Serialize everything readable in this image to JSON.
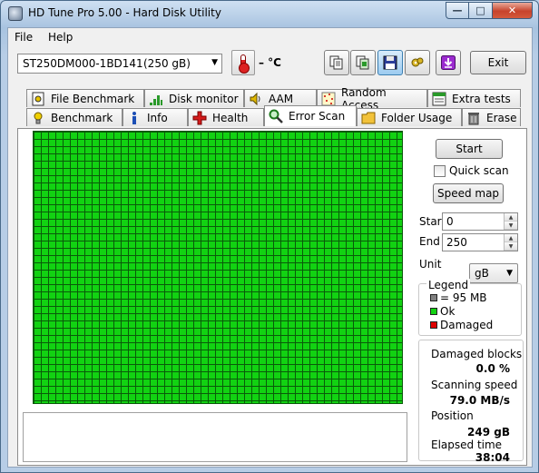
{
  "window": {
    "title": "HD Tune Pro 5.00 - Hard Disk Utility",
    "minimize": "—",
    "maximize": "□",
    "close": "✕"
  },
  "menu": {
    "file": "File",
    "help": "Help"
  },
  "toolbar": {
    "drive_name": "ST250DM000-1BD141",
    "drive_size": "(250 gB)",
    "temperature": "– °C",
    "exit_label": "Exit",
    "icons": [
      "copy-info-icon",
      "copy-screenshot-icon",
      "save-icon",
      "options-icon",
      "download-icon"
    ]
  },
  "tabs_top": [
    {
      "label": "File Benchmark",
      "icon": "file-benchmark-icon"
    },
    {
      "label": "Disk monitor",
      "icon": "disk-monitor-icon"
    },
    {
      "label": "AAM",
      "icon": "speaker-icon"
    },
    {
      "label": "Random Access",
      "icon": "random-access-icon"
    },
    {
      "label": "Extra tests",
      "icon": "extra-tests-icon"
    }
  ],
  "tabs_bottom": [
    {
      "label": "Benchmark",
      "icon": "benchmark-icon"
    },
    {
      "label": "Info",
      "icon": "info-icon"
    },
    {
      "label": "Health",
      "icon": "health-icon"
    },
    {
      "label": "Error Scan",
      "icon": "magnifier-icon",
      "selected": true
    },
    {
      "label": "Folder Usage",
      "icon": "folder-icon"
    },
    {
      "label": "Erase",
      "icon": "trash-icon"
    }
  ],
  "scan": {
    "start_button": "Start",
    "quick_scan_label": "Quick scan",
    "quick_scan_checked": false,
    "speed_map_button": "Speed map",
    "start_label": "Start",
    "start_value": "0",
    "end_label": "End",
    "end_value": "250",
    "unit_label": "Unit",
    "unit_value": "gB",
    "grid_ok_fraction": 1.0
  },
  "legend": {
    "title": "Legend",
    "block_label": "= 95 MB",
    "ok_label": "Ok",
    "damaged_label": "Damaged",
    "colors": {
      "block": "#808080",
      "ok": "#12d212",
      "damaged": "#e00000"
    }
  },
  "stats": {
    "damaged_blocks_label": "Damaged blocks",
    "damaged_blocks_value": "0.0 %",
    "scanning_speed_label": "Scanning speed",
    "scanning_speed_value": "79.0 MB/s",
    "position_label": "Position",
    "position_value": "249 gB",
    "elapsed_label": "Elapsed time",
    "elapsed_value": "38:04"
  }
}
